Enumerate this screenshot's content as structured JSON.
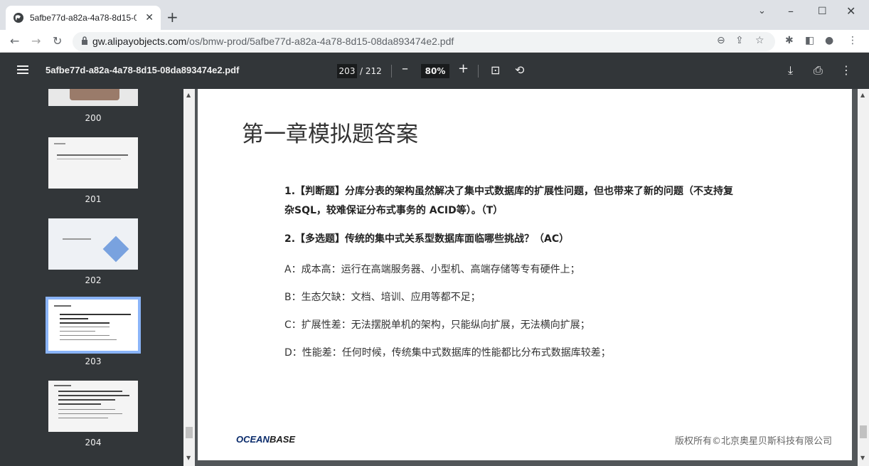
{
  "browser": {
    "tab_title": "5afbe77d-a82a-4a78-8d15-08",
    "url_host": "gw.alipayobjects.com",
    "url_path": "/os/bmw-prod/5afbe77d-a82a-4a78-8d15-08da893474e2.pdf"
  },
  "pdf_toolbar": {
    "filename": "5afbe77d-a82a-4a78-8d15-08da893474e2.pdf",
    "current_page": "203",
    "total_pages": "/ 212",
    "zoom": "80%"
  },
  "sidebar": {
    "pages": [
      {
        "num": "200"
      },
      {
        "num": "201"
      },
      {
        "num": "202"
      },
      {
        "num": "203",
        "selected": true
      },
      {
        "num": "204"
      }
    ]
  },
  "page": {
    "title": "第一章模拟题答案",
    "q1_line1": "1.【判断题】分库分表的架构虽然解决了集中式数据库的扩展性问题，但也带来了新的问题（不支持复",
    "q1_line2": "杂SQL，较难保证分布式事务的 ACID等）。（T）",
    "q2": "2.【多选题】传统的集中式关系型数据库面临哪些挑战？（AC）",
    "options": [
      "A：成本高：运行在高端服务器、小型机、高端存储等专有硬件上；",
      "B：生态欠缺：文档、培训、应用等都不足；",
      "C：扩展性差：无法摆脱单机的架构，只能纵向扩展，无法横向扩展；",
      "D：性能差：任何时候，传统集中式数据库的性能都比分布式数据库较差；"
    ],
    "logo_a": "OCEAN",
    "logo_b": "BASE",
    "copyright": "版权所有©北京奥星贝斯科技有限公司"
  }
}
